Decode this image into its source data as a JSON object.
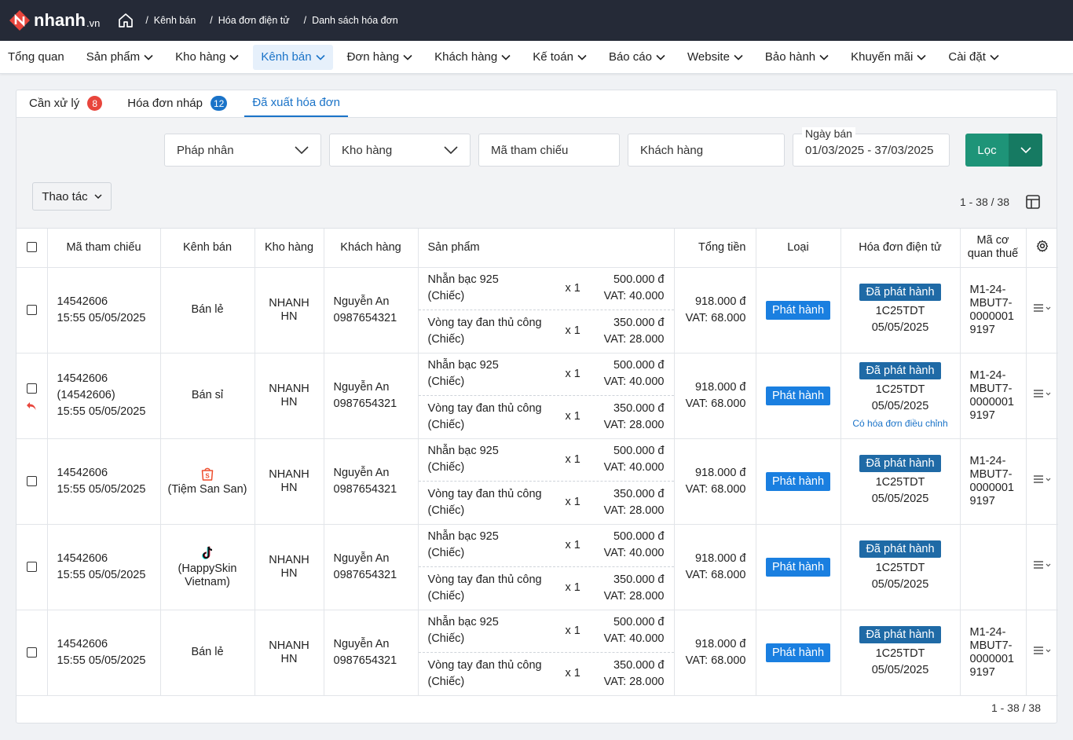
{
  "brand": {
    "name": "nhanh",
    "suffix": ".vn",
    "color": "#e8453c"
  },
  "breadcrumb": [
    "Kênh bán",
    "Hóa đơn điện tử",
    "Danh sách hóa đơn"
  ],
  "nav": [
    {
      "label": "Tổng quan",
      "dropdown": false
    },
    {
      "label": "Sản phẩm",
      "dropdown": true
    },
    {
      "label": "Kho hàng",
      "dropdown": true
    },
    {
      "label": "Kênh bán",
      "dropdown": true,
      "active": true
    },
    {
      "label": "Đơn hàng",
      "dropdown": true
    },
    {
      "label": "Khách hàng",
      "dropdown": true
    },
    {
      "label": "Kế toán",
      "dropdown": true
    },
    {
      "label": "Báo cáo",
      "dropdown": true
    },
    {
      "label": "Website",
      "dropdown": true
    },
    {
      "label": "Bảo hành",
      "dropdown": true
    },
    {
      "label": "Khuyến mãi",
      "dropdown": true
    },
    {
      "label": "Cài đặt",
      "dropdown": true
    }
  ],
  "tabs": [
    {
      "label": "Cần xử lý",
      "badge": "8"
    },
    {
      "label": "Hóa đơn nháp",
      "badge": "12"
    },
    {
      "label": "Đã xuất hóa đơn",
      "active": true
    }
  ],
  "filters": {
    "phap_nhan": "Pháp nhân",
    "kho_hang": "Kho hàng",
    "ma_tham_chieu": "Mã tham chiếu",
    "khach_hang": "Khách hàng",
    "ngay_ban_label": "Ngày bán",
    "ngay_ban_value": "01/03/2025 - 37/03/2025",
    "filter_button": "Lọc"
  },
  "actions_label": "Thao tác",
  "pagination": "1 - 38 / 38",
  "columns": [
    "Mã tham chiếu",
    "Kênh bán",
    "Kho hàng",
    "Khách hàng",
    "Sản phẩm",
    "Tổng tiền",
    "Loại",
    "Hóa đơn điện tử",
    "Mã cơ quan thuế"
  ],
  "rows": [
    {
      "ref": "14542606",
      "ref2": "",
      "time": "15:55 05/05/2025",
      "channel": "Bán lẻ",
      "channel_icon": "",
      "warehouse": [
        "NHANH",
        "HN"
      ],
      "customer": "Nguyễn An",
      "phone": "0987654321",
      "products": [
        {
          "name": "Nhẫn bạc 925",
          "unit": "(Chiếc)",
          "qty": "x 1",
          "price": "500.000 đ",
          "vat": "VAT: 40.000"
        },
        {
          "name": "Vòng tay đan thủ công",
          "unit": "(Chiếc)",
          "qty": "x 1",
          "price": "350.000 đ",
          "vat": "VAT: 28.000"
        }
      ],
      "total": "918.000 đ",
      "total_vat": "VAT: 68.000",
      "type": "Phát hành",
      "status": "Đã phát hành",
      "invoice_code": "1C25TDT",
      "invoice_date": "05/05/2025",
      "note": "",
      "tax": [
        "M1-24-",
        "MBUT7-",
        "0000001",
        "9197"
      ],
      "returned": false
    },
    {
      "ref": "14542606",
      "ref2": "(14542606)",
      "time": "15:55 05/05/2025",
      "channel": "Bán sỉ",
      "channel_icon": "",
      "warehouse": [
        "NHANH",
        "HN"
      ],
      "customer": "Nguyễn An",
      "phone": "0987654321",
      "products": [
        {
          "name": "Nhẫn bạc 925",
          "unit": "(Chiếc)",
          "qty": "x 1",
          "price": "500.000 đ",
          "vat": "VAT: 40.000"
        },
        {
          "name": "Vòng tay đan thủ công",
          "unit": "(Chiếc)",
          "qty": "x 1",
          "price": "350.000 đ",
          "vat": "VAT: 28.000"
        }
      ],
      "total": "918.000 đ",
      "total_vat": "VAT: 68.000",
      "type": "Phát hành",
      "status": "Đã phát hành",
      "invoice_code": "1C25TDT",
      "invoice_date": "05/05/2025",
      "note": "Có hóa đơn điều chỉnh",
      "tax": [
        "M1-24-",
        "MBUT7-",
        "0000001",
        "9197"
      ],
      "returned": true
    },
    {
      "ref": "14542606",
      "ref2": "",
      "time": "15:55 05/05/2025",
      "channel": "(Tiệm San San)",
      "channel_icon": "shopee",
      "warehouse": [
        "NHANH",
        "HN"
      ],
      "customer": "Nguyễn An",
      "phone": "0987654321",
      "products": [
        {
          "name": "Nhẫn bạc 925",
          "unit": "(Chiếc)",
          "qty": "x 1",
          "price": "500.000 đ",
          "vat": "VAT: 40.000"
        },
        {
          "name": "Vòng tay đan thủ công",
          "unit": "(Chiếc)",
          "qty": "x 1",
          "price": "350.000 đ",
          "vat": "VAT: 28.000"
        }
      ],
      "total": "918.000 đ",
      "total_vat": "VAT: 68.000",
      "type": "Phát hành",
      "status": "Đã phát hành",
      "invoice_code": "1C25TDT",
      "invoice_date": "05/05/2025",
      "note": "",
      "tax": [
        "M1-24-",
        "MBUT7-",
        "0000001",
        "9197"
      ],
      "returned": false
    },
    {
      "ref": "14542606",
      "ref2": "",
      "time": "15:55 05/05/2025",
      "channel": "(HappySkin Vietnam)",
      "channel_icon": "tiktok",
      "warehouse": [
        "NHANH",
        "HN"
      ],
      "customer": "Nguyễn An",
      "phone": "0987654321",
      "products": [
        {
          "name": "Nhẫn bạc 925",
          "unit": "(Chiếc)",
          "qty": "x 1",
          "price": "500.000 đ",
          "vat": "VAT: 40.000"
        },
        {
          "name": "Vòng tay đan thủ công",
          "unit": "(Chiếc)",
          "qty": "x 1",
          "price": "350.000 đ",
          "vat": "VAT: 28.000"
        }
      ],
      "total": "918.000 đ",
      "total_vat": "VAT: 68.000",
      "type": "Phát hành",
      "status": "Đã phát hành",
      "invoice_code": "1C25TDT",
      "invoice_date": "05/05/2025",
      "note": "",
      "tax": [],
      "returned": false
    },
    {
      "ref": "14542606",
      "ref2": "",
      "time": "15:55 05/05/2025",
      "channel": "Bán lẻ",
      "channel_icon": "",
      "warehouse": [
        "NHANH",
        "HN"
      ],
      "customer": "Nguyễn An",
      "phone": "0987654321",
      "products": [
        {
          "name": "Nhẫn bạc 925",
          "unit": "(Chiếc)",
          "qty": "x 1",
          "price": "500.000 đ",
          "vat": "VAT: 40.000"
        },
        {
          "name": "Vòng tay đan thủ công",
          "unit": "(Chiếc)",
          "qty": "x 1",
          "price": "350.000 đ",
          "vat": "VAT: 28.000"
        }
      ],
      "total": "918.000 đ",
      "total_vat": "VAT: 68.000",
      "type": "Phát hành",
      "status": "Đã phát hành",
      "invoice_code": "1C25TDT",
      "invoice_date": "05/05/2025",
      "note": "",
      "tax": [
        "M1-24-",
        "MBUT7-",
        "0000001",
        "9197"
      ],
      "returned": false
    }
  ]
}
